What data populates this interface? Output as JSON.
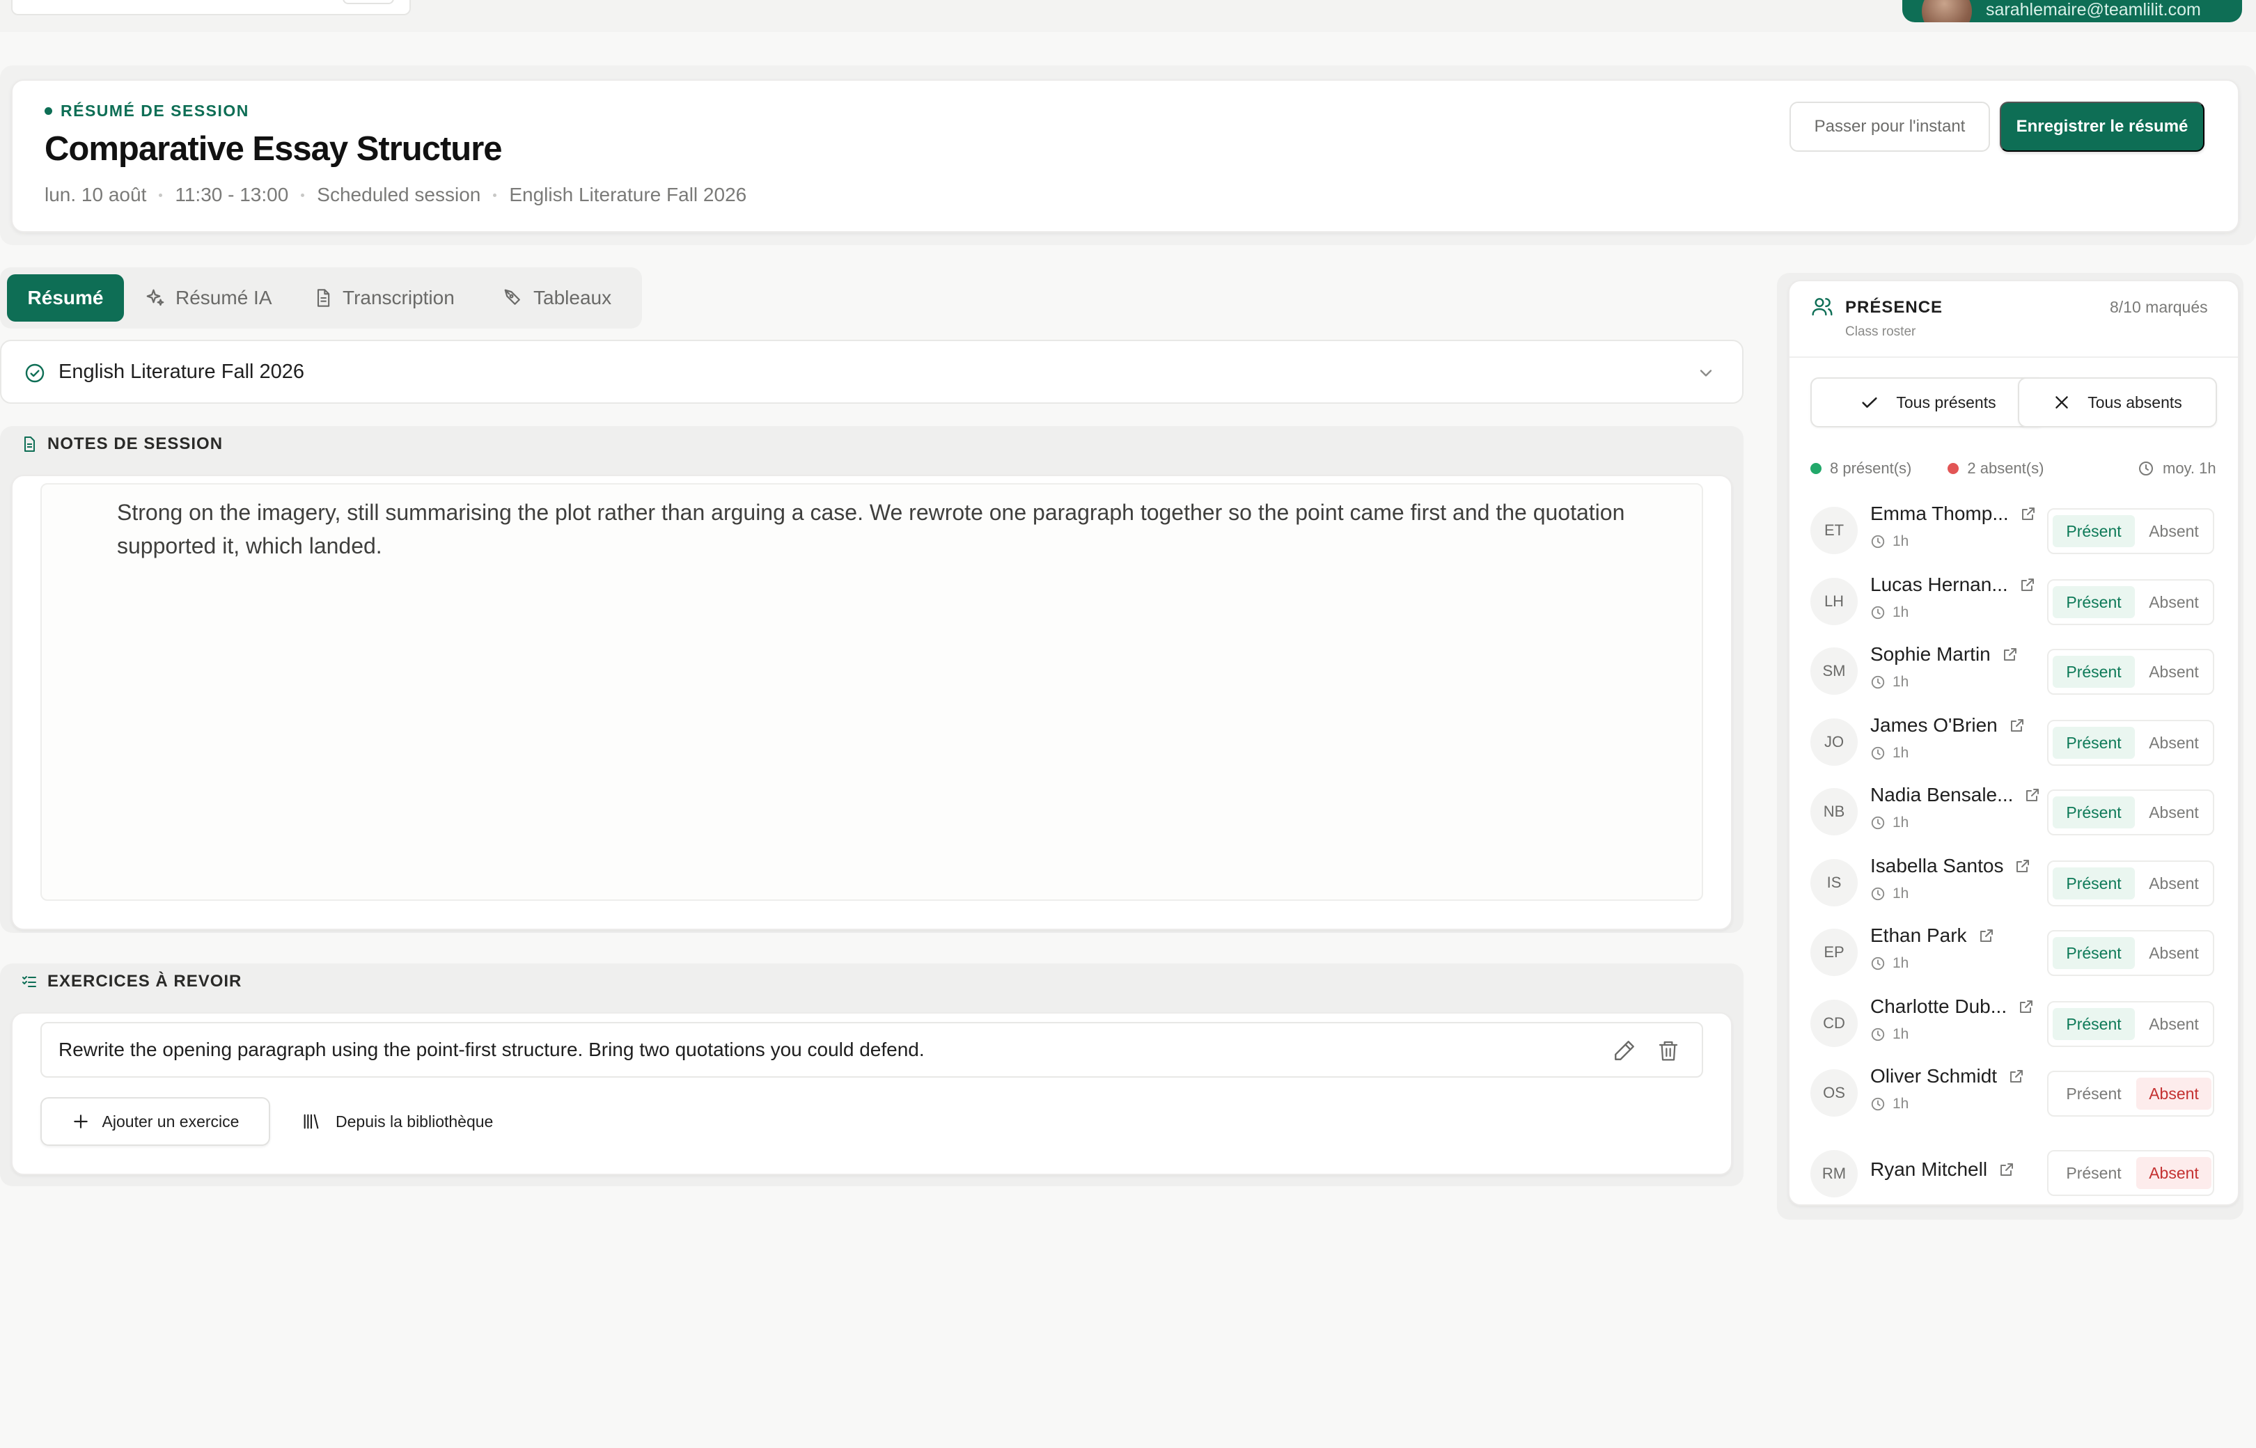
{
  "topbar": {
    "user_email": "sarahlemaire@teamlilit.com"
  },
  "session": {
    "eyebrow": "RÉSUMÉ DE SESSION",
    "title": "Comparative Essay Structure",
    "date": "lun. 10 août",
    "time": "11:30 - 13:00",
    "type": "Scheduled session",
    "course": "English Literature Fall 2026",
    "skip_label": "Passer pour l'instant",
    "save_label": "Enregistrer le résumé"
  },
  "tabs": [
    {
      "label": "Résumé",
      "icon": "none",
      "active": true
    },
    {
      "label": "Résumé IA",
      "icon": "sparkles-icon",
      "active": false
    },
    {
      "label": "Transcription",
      "icon": "document-icon",
      "active": false
    },
    {
      "label": "Tableaux",
      "icon": "pen-tool-icon",
      "active": false
    }
  ],
  "course_select": {
    "value": "English Literature Fall 2026"
  },
  "notes": {
    "heading": "NOTES DE SESSION",
    "text": "Strong on the imagery, still summarising the plot rather than arguing a case. We rewrote one paragraph together so the point came first and the quotation supported it, which landed."
  },
  "exercises": {
    "heading": "EXERCICES À REVOIR",
    "items": [
      "Rewrite the opening paragraph using the point-first structure. Bring two quotations you could defend."
    ],
    "add_label": "Ajouter un exercice",
    "library_label": "Depuis la bibliothèque"
  },
  "attendance": {
    "title": "PRÉSENCE",
    "subtitle": "Class roster",
    "marked": "8/10 marqués",
    "all_present_label": "Tous présents",
    "all_absent_label": "Tous absents",
    "present_count": "8 présent(s)",
    "absent_count": "2 absent(s)",
    "average": "moy. 1h",
    "present_label": "Présent",
    "absent_label": "Absent",
    "students": [
      {
        "initials": "ET",
        "name": "Emma Thomp...",
        "duration": "1h",
        "status": "present"
      },
      {
        "initials": "LH",
        "name": "Lucas Hernan...",
        "duration": "1h",
        "status": "present"
      },
      {
        "initials": "SM",
        "name": "Sophie Martin",
        "duration": "1h",
        "status": "present"
      },
      {
        "initials": "JO",
        "name": "James O'Brien",
        "duration": "1h",
        "status": "present"
      },
      {
        "initials": "NB",
        "name": "Nadia Bensale...",
        "duration": "1h",
        "status": "present"
      },
      {
        "initials": "IS",
        "name": "Isabella Santos",
        "duration": "1h",
        "status": "present"
      },
      {
        "initials": "EP",
        "name": "Ethan Park",
        "duration": "1h",
        "status": "present"
      },
      {
        "initials": "CD",
        "name": "Charlotte Dub...",
        "duration": "1h",
        "status": "present"
      },
      {
        "initials": "OS",
        "name": "Oliver Schmidt",
        "duration": "1h",
        "status": "absent"
      },
      {
        "initials": "RM",
        "name": "Ryan Mitchell",
        "duration": "",
        "status": "absent"
      }
    ]
  },
  "colors": {
    "accent": "#0e6e55",
    "present": "#22a86a",
    "absent": "#e25555"
  }
}
